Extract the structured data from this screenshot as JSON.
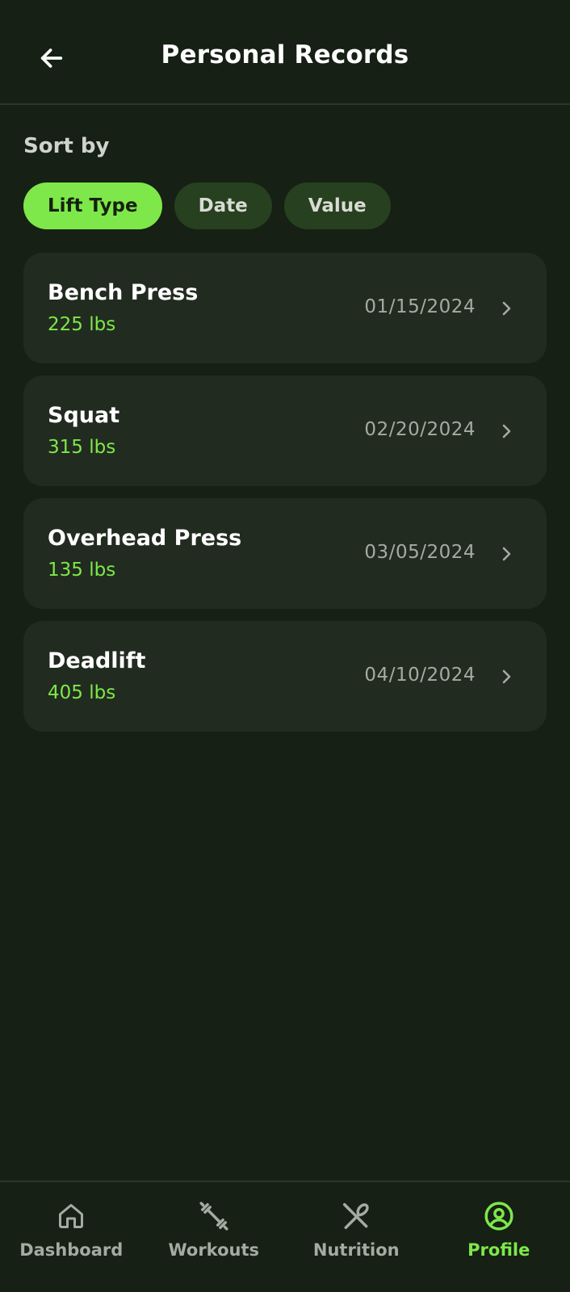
{
  "header": {
    "title": "Personal Records",
    "back_icon": "arrow-left-icon"
  },
  "sort": {
    "label": "Sort by",
    "options": [
      {
        "label": "Lift Type",
        "selected": true
      },
      {
        "label": "Date",
        "selected": false
      },
      {
        "label": "Value",
        "selected": false
      }
    ]
  },
  "records": [
    {
      "name": "Bench Press",
      "value": "225 lbs",
      "date": "01/15/2024"
    },
    {
      "name": "Squat",
      "value": "315 lbs",
      "date": "02/20/2024"
    },
    {
      "name": "Overhead Press",
      "value": "135 lbs",
      "date": "03/05/2024"
    },
    {
      "name": "Deadlift",
      "value": "405 lbs",
      "date": "04/10/2024"
    }
  ],
  "nav": {
    "items": [
      {
        "label": "Dashboard",
        "icon": "home-icon",
        "active": false
      },
      {
        "label": "Workouts",
        "icon": "dumbbell-icon",
        "active": false
      },
      {
        "label": "Nutrition",
        "icon": "utensils-icon",
        "active": false
      },
      {
        "label": "Profile",
        "icon": "user-circle-icon",
        "active": true
      }
    ]
  },
  "colors": {
    "background": "#162014",
    "accent": "#7ee84a",
    "card": "#222b20",
    "chip_inactive": "#27401f",
    "muted_text": "#a5aba2"
  }
}
